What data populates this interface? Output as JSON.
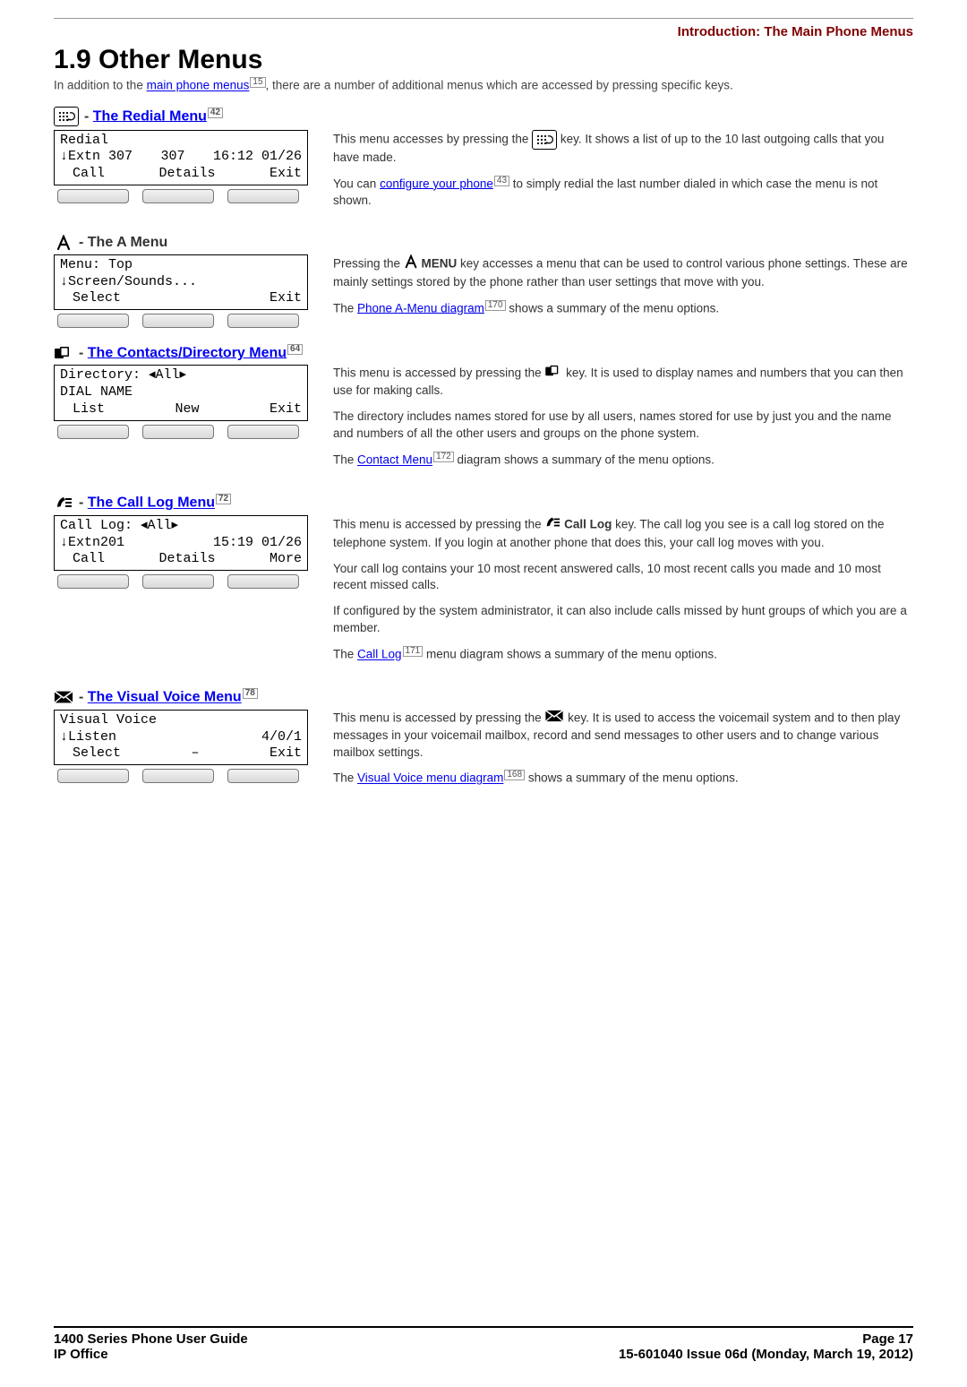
{
  "header": {
    "crumb": "Introduction: The Main Phone Menus"
  },
  "title": "1.9 Other Menus",
  "intro_pre": "In addition to the ",
  "intro_link": "main phone menus",
  "intro_sup": "15",
  "intro_post": ", there are a number of additional menus which are accessed by pressing specific keys.",
  "redial": {
    "heading_sep": " - ",
    "heading_link": "The Redial Menu",
    "heading_sup": "42",
    "lcd_r1_a": "Redial",
    "lcd_r2_a": "↓Extn 307",
    "lcd_r2_b": "307",
    "lcd_r2_c": "16:12 01/26",
    "lcd_r3_a": "Call",
    "lcd_r3_b": "Details",
    "lcd_r3_c": "Exit",
    "p1_pre": "This menu accesses by pressing the ",
    "p1_post": " key. It shows a list of up to the 10 last outgoing calls that you have made.",
    "p2_pre": "You can ",
    "p2_link": "configure your phone",
    "p2_sup": "43",
    "p2_post": " to simply redial the last number dialed in which case the menu is not shown."
  },
  "amenu": {
    "heading": " - The A Menu",
    "lcd_r1": "Menu: Top",
    "lcd_r2": "↓Screen/Sounds...",
    "lcd_r3_a": "Select",
    "lcd_r3_c": "Exit",
    "p1_pre": "Pressing the ",
    "p1_mid": " MENU",
    "p1_post": " key accesses a menu that can be used to control various phone settings. These are mainly settings stored by the phone rather than user settings that move with you.",
    "p2_pre": "The ",
    "p2_link": "Phone A-Menu diagram",
    "p2_sup": "170",
    "p2_post": " shows a summary of the menu options."
  },
  "contacts": {
    "heading_sep": " - ",
    "heading_link": "The Contacts/Directory Menu",
    "heading_sup": "64",
    "lcd_r1": "Directory: ◂All▸",
    "lcd_r2": "DIAL NAME",
    "lcd_r3_a": "List",
    "lcd_r3_b": "New",
    "lcd_r3_c": "Exit",
    "p1_pre": "This menu is accessed by pressing the ",
    "p1_post": " key. It is used to display names and numbers that you can then use for making calls.",
    "p2": "The directory includes names stored for use by all users, names stored for use by just you and the name and numbers of all the other users and groups on the phone system.",
    "p3_pre": "The ",
    "p3_link": "Contact Menu",
    "p3_sup": "172",
    "p3_post": " diagram shows a summary of the menu options."
  },
  "calllog": {
    "heading_sep": " - ",
    "heading_link": "The Call Log Menu",
    "heading_sup": "72",
    "lcd_r1": "Call Log: ◂All▸",
    "lcd_r2_a": "↓Extn201",
    "lcd_r2_c": "15:19 01/26",
    "lcd_r3_a": "Call",
    "lcd_r3_b": "Details",
    "lcd_r3_c": "More",
    "p1_pre": "This menu is accessed by pressing the ",
    "p1_mid": " Call Log",
    "p1_post": " key. The call log you see is a call log stored on the telephone system. If you login at another phone that does this, your call log moves with you.",
    "p2": "Your call log contains your 10 most recent answered calls, 10 most recent calls you made and 10 most recent missed calls.",
    "p3": "If configured by the system administrator, it can also include calls missed by hunt groups of which you are a member.",
    "p4_pre": "The ",
    "p4_link": "Call Log",
    "p4_sup": "171",
    "p4_post": " menu diagram shows a summary of the menu options."
  },
  "voice": {
    "heading_sep": " - ",
    "heading_link": "The Visual Voice Menu",
    "heading_sup": "78",
    "lcd_r1": "Visual Voice",
    "lcd_r2_a": "↓Listen",
    "lcd_r2_c": "4/0/1",
    "lcd_r3_a": "Select",
    "lcd_r3_b": "–",
    "lcd_r3_c": "Exit",
    "p1_pre": "This menu is accessed by pressing the ",
    "p1_post": " key. It is used to access the voicemail system and to then play messages in your voicemail mailbox, record and send messages to other users and to change various mailbox settings.",
    "p2_pre": "The ",
    "p2_link": "Visual Voice menu diagram",
    "p2_sup": "168",
    "p2_post": " shows a summary of the menu options."
  },
  "footer": {
    "left1": "1400 Series Phone User Guide",
    "left2": "IP Office",
    "right1": "Page 17",
    "right2": "15-601040 Issue 06d (Monday, March 19, 2012)"
  }
}
